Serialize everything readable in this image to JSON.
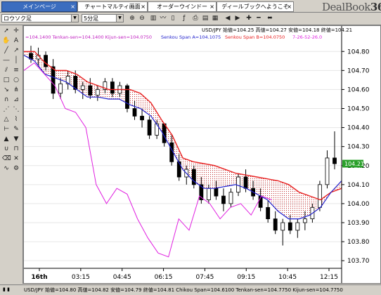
{
  "tabs": [
    {
      "label": "メインページ",
      "active": true
    },
    {
      "label": "チャートマルティ画面",
      "active": false
    },
    {
      "label": "オーダーウインドー",
      "active": false
    },
    {
      "label": "ディールブックへようこそ",
      "active": false
    }
  ],
  "tab_close_glyph": "×",
  "logo": {
    "text": "DealBook",
    "suffix": "360"
  },
  "toolbar": {
    "symbol_select": "ロウソク足",
    "period_select": "5分足"
  },
  "chart_info": {
    "symbol_line": "USD/JPY 始値=104.25 高値=104.27 安値=104.18 終値=104.21",
    "indicator_line_purple": "=104.1400 Tenkan-sen=104.1400 Kijun-sen=104.0750",
    "indicator_line_blue": "Senkou Span A=104.1075",
    "indicator_line_red": "Senkou Span B=104.0750",
    "indicator_line_pink": "7-26-52-26.0"
  },
  "status": {
    "text": "USD/JPY 始値=104.80 高値=104.82 安値=104.79 終値=104.81  Chikou Span=104.6100 Tenkan-sen=104.7750 Kijun-sen=104.7750",
    "left_marks": "▮ ▮"
  },
  "colors": {
    "tenkan": "#1f1fcc",
    "kijun": "#e82020",
    "chikou": "#e020e0",
    "cloud": "#c03030",
    "price_label_bg": "#2aa02a"
  },
  "chart_data": {
    "type": "candlestick",
    "pair": "USD/JPY",
    "timeframe": "5分足",
    "y_axis_ticks": [
      104.8,
      104.7,
      104.6,
      104.5,
      104.4,
      104.3,
      104.2,
      104.1,
      104.0,
      103.9,
      103.8,
      103.7
    ],
    "ylim": [
      103.66,
      104.86
    ],
    "x_axis_ticks": [
      "16th",
      "03:15",
      "04:45",
      "06:15",
      "07:45",
      "09:15",
      "10:45",
      "12:15"
    ],
    "current_price_label": "104.21",
    "kijun_sen": [
      104.8,
      104.8,
      104.74,
      104.7,
      104.7,
      104.68,
      104.64,
      104.62,
      104.6,
      104.6,
      104.6,
      104.58,
      104.53,
      104.44,
      104.36,
      104.24,
      104.22,
      104.21,
      104.2,
      104.18,
      104.16,
      104.15,
      104.14,
      104.13,
      104.12,
      104.1,
      104.06,
      104.04,
      104.02,
      104.06,
      104.08
    ],
    "tenkan_sen": [
      104.78,
      104.75,
      104.68,
      104.66,
      104.64,
      104.6,
      104.56,
      104.56,
      104.55,
      104.55,
      104.52,
      104.5,
      104.46,
      104.38,
      104.28,
      104.18,
      104.12,
      104.08,
      104.08,
      104.09,
      104.1,
      104.08,
      104.05,
      104.02,
      103.96,
      103.92,
      103.92,
      103.94,
      103.98,
      104.06,
      104.12
    ],
    "chikou_span": [
      104.7,
      104.74,
      104.68,
      104.62,
      104.5,
      104.48,
      104.4,
      104.1,
      104.0,
      104.08,
      104.05,
      103.92,
      103.82,
      103.74,
      103.72,
      103.92,
      103.86,
      104.04,
      104.0,
      103.92,
      103.98,
      104.0,
      103.94,
      104.04,
      104.02
    ],
    "candles": [
      [
        104.79,
        104.83,
        104.74,
        104.76
      ],
      [
        104.76,
        104.82,
        104.72,
        104.78
      ],
      [
        104.78,
        104.8,
        104.7,
        104.72
      ],
      [
        104.72,
        104.76,
        104.55,
        104.58
      ],
      [
        104.58,
        104.66,
        104.55,
        104.63
      ],
      [
        104.63,
        104.7,
        104.6,
        104.67
      ],
      [
        104.67,
        104.7,
        104.58,
        104.6
      ],
      [
        104.6,
        104.64,
        104.55,
        104.62
      ],
      [
        104.62,
        104.66,
        104.55,
        104.57
      ],
      [
        104.57,
        104.62,
        104.54,
        104.6
      ],
      [
        104.6,
        104.66,
        104.58,
        104.64
      ],
      [
        104.64,
        104.66,
        104.56,
        104.58
      ],
      [
        104.58,
        104.64,
        104.56,
        104.62
      ],
      [
        104.62,
        104.63,
        104.48,
        104.5
      ],
      [
        104.5,
        104.54,
        104.44,
        104.46
      ],
      [
        104.46,
        104.5,
        104.4,
        104.44
      ],
      [
        104.44,
        104.46,
        104.34,
        104.36
      ],
      [
        104.36,
        104.44,
        104.34,
        104.42
      ],
      [
        104.42,
        104.42,
        104.3,
        104.32
      ],
      [
        104.32,
        104.36,
        104.2,
        104.22
      ],
      [
        104.22,
        104.26,
        104.12,
        104.14
      ],
      [
        104.14,
        104.2,
        104.1,
        104.18
      ],
      [
        104.18,
        104.2,
        104.08,
        104.1
      ],
      [
        104.1,
        104.14,
        104.0,
        104.02
      ],
      [
        104.02,
        104.1,
        104.0,
        104.08
      ],
      [
        104.08,
        104.12,
        104.02,
        104.04
      ],
      [
        104.04,
        104.08,
        103.96,
        104.0
      ],
      [
        104.0,
        104.08,
        103.98,
        104.06
      ],
      [
        104.06,
        104.16,
        104.04,
        104.14
      ],
      [
        104.14,
        104.18,
        104.06,
        104.08
      ],
      [
        104.08,
        104.12,
        104.02,
        104.04
      ],
      [
        104.04,
        104.08,
        103.96,
        103.98
      ],
      [
        103.98,
        104.02,
        103.9,
        103.92
      ],
      [
        103.92,
        103.96,
        103.84,
        103.86
      ],
      [
        103.86,
        103.92,
        103.78,
        103.9
      ],
      [
        103.9,
        103.94,
        103.84,
        103.86
      ],
      [
        103.86,
        103.92,
        103.82,
        103.9
      ],
      [
        103.9,
        103.96,
        103.86,
        103.92
      ],
      [
        103.92,
        104.0,
        103.9,
        103.98
      ],
      [
        103.98,
        104.12,
        103.96,
        104.1
      ],
      [
        104.1,
        104.28,
        104.08,
        104.24
      ],
      [
        104.24,
        104.38,
        104.18,
        104.21
      ]
    ]
  }
}
